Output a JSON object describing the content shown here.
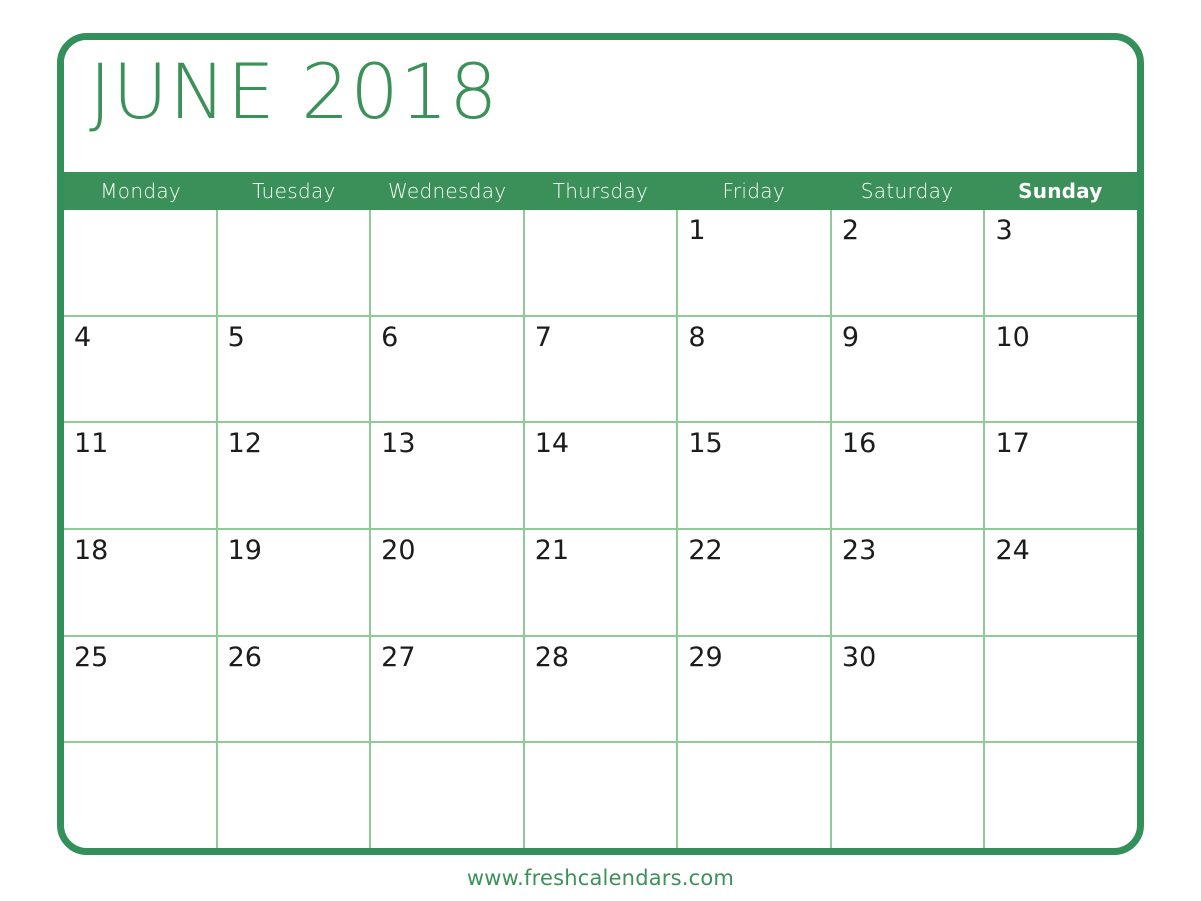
{
  "calendar": {
    "title": "JUNE 2018",
    "month": "JUNE",
    "year": "2018",
    "colors": {
      "frame": "#33905a",
      "header_band": "#3a9058",
      "title_text": "#3c9159",
      "gridline": "#8fcb95",
      "day_number": "#1c1c1c",
      "weekday_text": "#ffffff",
      "page_background": "#ffffff",
      "footer_text": "#3c9159"
    },
    "weekdays": [
      {
        "label": "Monday",
        "bold": false
      },
      {
        "label": "Tuesday",
        "bold": false
      },
      {
        "label": "Wednesday",
        "bold": false
      },
      {
        "label": "Thursday",
        "bold": false
      },
      {
        "label": "Friday",
        "bold": false
      },
      {
        "label": "Saturday",
        "bold": false
      },
      {
        "label": "Sunday",
        "bold": true
      }
    ],
    "weeks": [
      [
        "",
        "",
        "",
        "",
        "1",
        "2",
        "3"
      ],
      [
        "4",
        "5",
        "6",
        "7",
        "8",
        "9",
        "10"
      ],
      [
        "11",
        "12",
        "13",
        "14",
        "15",
        "16",
        "17"
      ],
      [
        "18",
        "19",
        "20",
        "21",
        "22",
        "23",
        "24"
      ],
      [
        "25",
        "26",
        "27",
        "28",
        "29",
        "30",
        ""
      ],
      [
        "",
        "",
        "",
        "",
        "",
        "",
        ""
      ]
    ]
  },
  "footer": {
    "website": "www.freshcalendars.com"
  }
}
